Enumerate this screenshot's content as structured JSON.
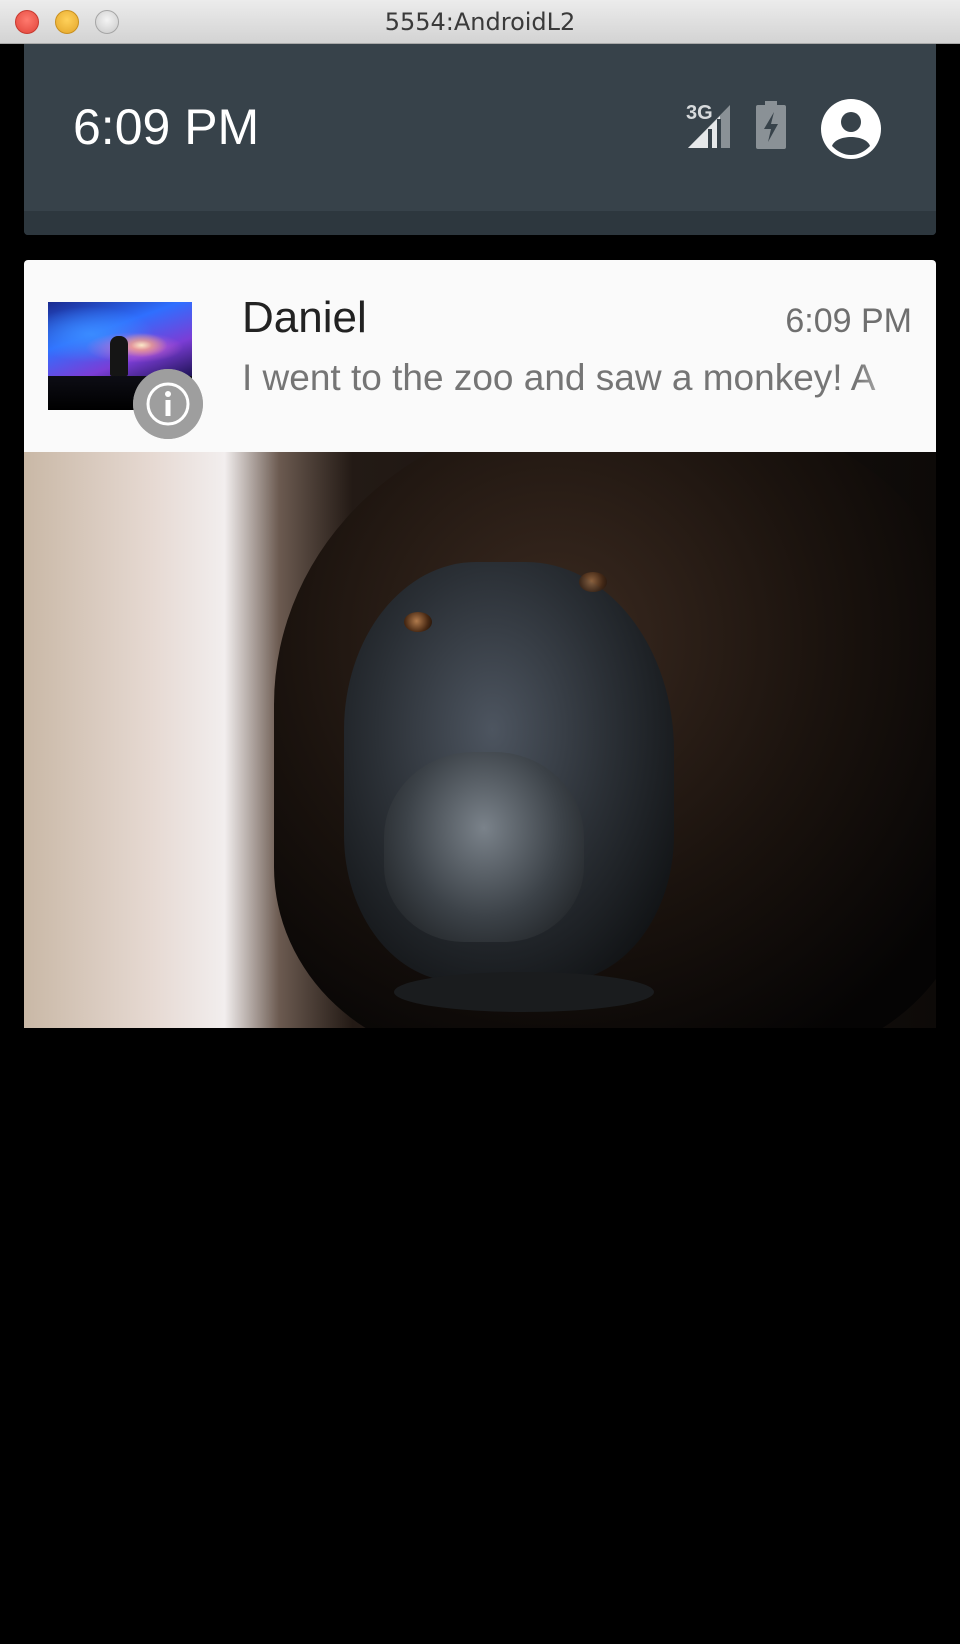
{
  "window": {
    "title": "5554:AndroidL2"
  },
  "status_header": {
    "clock": "6:09 PM",
    "network_label": "3G",
    "icons": [
      "signal-3g-icon",
      "battery-charging-icon",
      "user-account-icon"
    ]
  },
  "notification": {
    "sender": "Daniel",
    "time": "6:09 PM",
    "message": "I went to the zoo and saw a monkey! A",
    "thumbnail": "galaxy-avatar-image",
    "badge_icon": "info-icon",
    "big_picture": "gorilla-photo"
  },
  "colors": {
    "header_bg": "#37424a",
    "card_bg": "#fafafa",
    "badge": "#9e9e9e"
  }
}
